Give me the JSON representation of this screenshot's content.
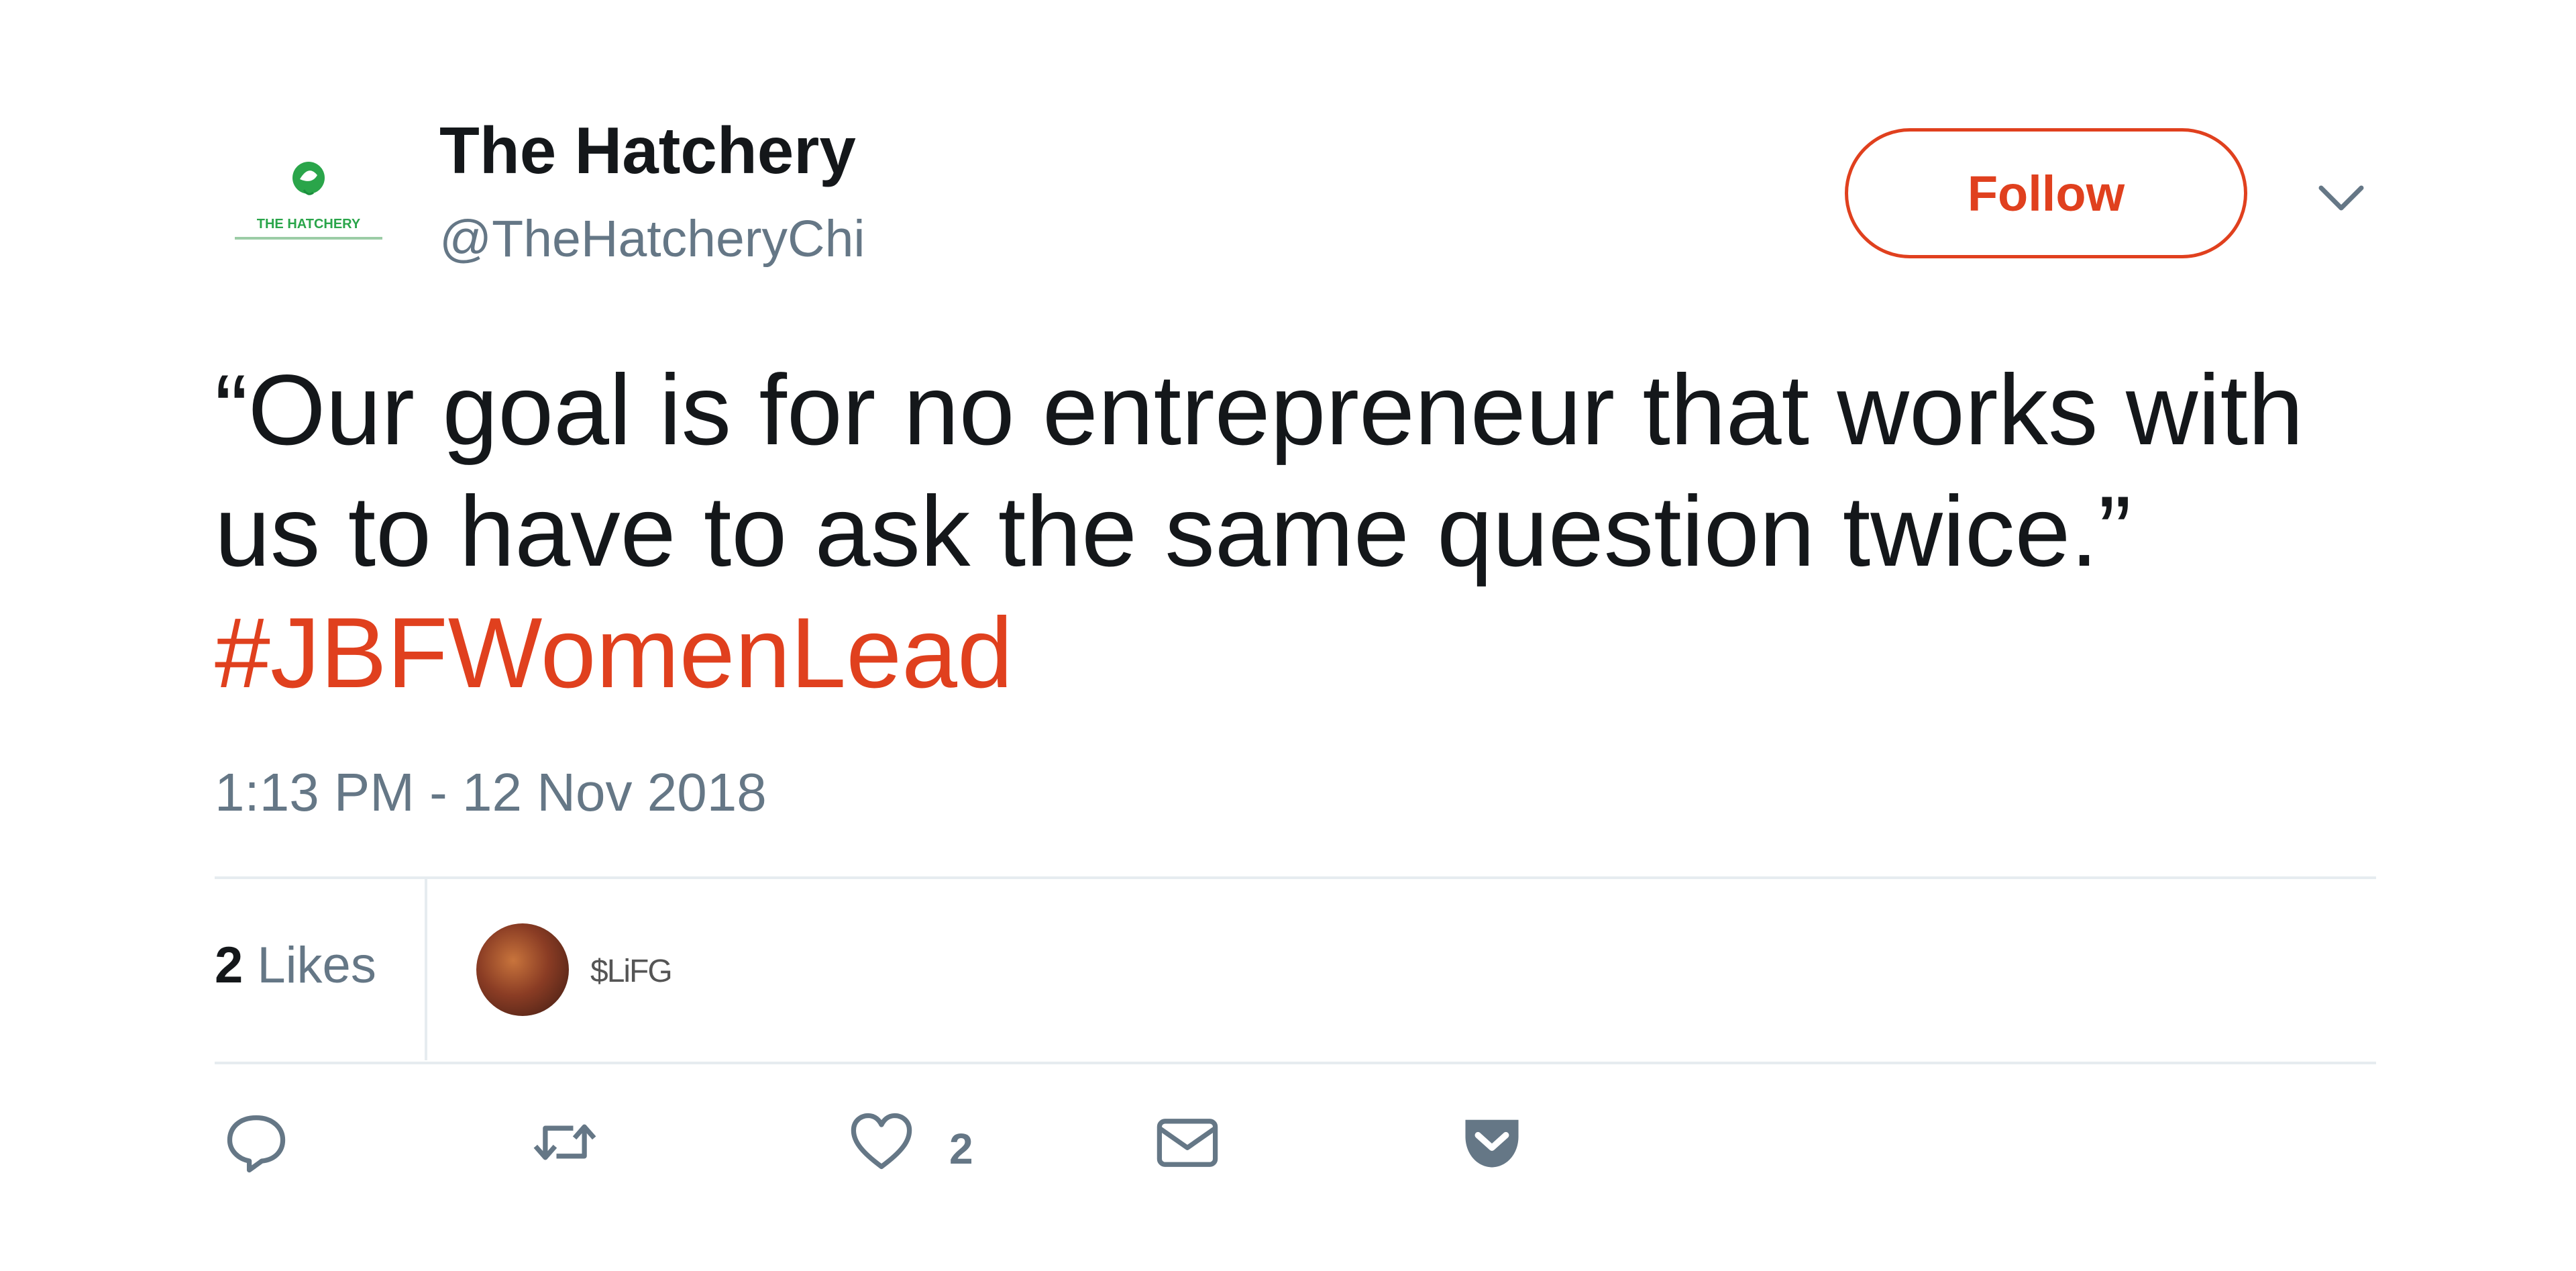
{
  "account": {
    "name": "The Hatchery",
    "handle": "@TheHatcheryChi",
    "avatar_text": "THE HATCHERY"
  },
  "header": {
    "follow_label": "Follow",
    "caret_icon": "chevron-down-icon"
  },
  "tweet": {
    "text": "“Our goal is for no entrepreneur that works with us to have to ask the same question twice.”",
    "hashtag": "#JBFWomenLead",
    "timestamp": "1:13 PM - 12 Nov 2018"
  },
  "stats": {
    "likes_count": "2",
    "likes_label": "Likes",
    "liker_name": "$LiFG"
  },
  "actions": {
    "reply_icon": "reply-icon",
    "retweet_icon": "retweet-icon",
    "like_icon": "heart-icon",
    "like_count": "2",
    "dm_icon": "mail-icon",
    "pocket_icon": "pocket-icon"
  },
  "colors": {
    "accent": "#e0401e",
    "text_primary": "#14171a",
    "text_secondary": "#657786",
    "divider": "#e6ecf0",
    "logo_green": "#2aa54a"
  }
}
